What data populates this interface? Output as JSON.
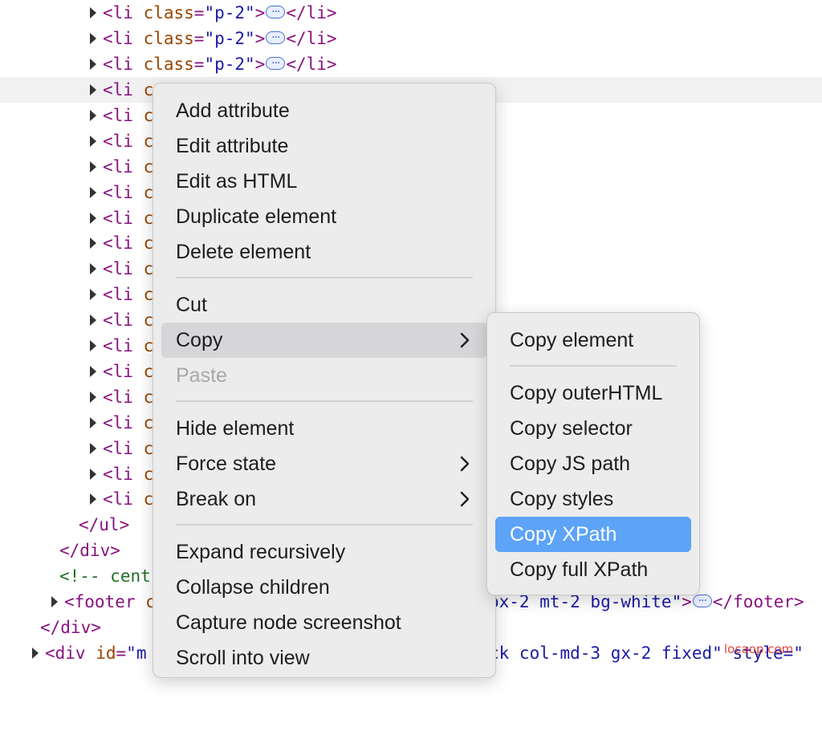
{
  "code": {
    "li_open": "<li ",
    "li_attr": "class",
    "li_eq": "=",
    "li_val": "\"p-2\"",
    "li_gt": ">",
    "li_close": "</li>",
    "li_short_attr": "c",
    "ul_close": "</ul>",
    "div_close_1": "</div>",
    "comment_fragment": "<!-- cent",
    "footer_open": "<footer ",
    "footer_attr_fragment": "c",
    "footer_val_tail": "ox-2 mt-2 bg-white\"",
    "footer_gt": ">",
    "footer_close": "</footer>",
    "div_close_2": "</div>",
    "div_open": "<div ",
    "div_id_attr": "id",
    "div_eq": "=",
    "div_id_fragment": "\"m",
    "div_class_tail": "ck col-md-3 gx-2 fixed",
    "div_style_tail": "\" style=\""
  },
  "context_menu": {
    "items": [
      {
        "label": "Add attribute"
      },
      {
        "label": "Edit attribute"
      },
      {
        "label": "Edit as HTML"
      },
      {
        "label": "Duplicate element"
      },
      {
        "label": "Delete element"
      },
      {
        "label": "Cut"
      },
      {
        "label": "Copy"
      },
      {
        "label": "Paste"
      },
      {
        "label": "Hide element"
      },
      {
        "label": "Force state"
      },
      {
        "label": "Break on"
      },
      {
        "label": "Expand recursively"
      },
      {
        "label": "Collapse children"
      },
      {
        "label": "Capture node screenshot"
      },
      {
        "label": "Scroll into view"
      }
    ]
  },
  "copy_submenu": {
    "items": [
      {
        "label": "Copy element"
      },
      {
        "label": "Copy outerHTML"
      },
      {
        "label": "Copy selector"
      },
      {
        "label": "Copy JS path"
      },
      {
        "label": "Copy styles"
      },
      {
        "label": "Copy XPath"
      },
      {
        "label": "Copy full XPath"
      }
    ]
  },
  "watermark": "locaop.com",
  "colors": {
    "tag": "#881280",
    "attr": "#994500",
    "value": "#1a1aa6",
    "comment": "#236e25",
    "selection": "#5da3f7"
  }
}
